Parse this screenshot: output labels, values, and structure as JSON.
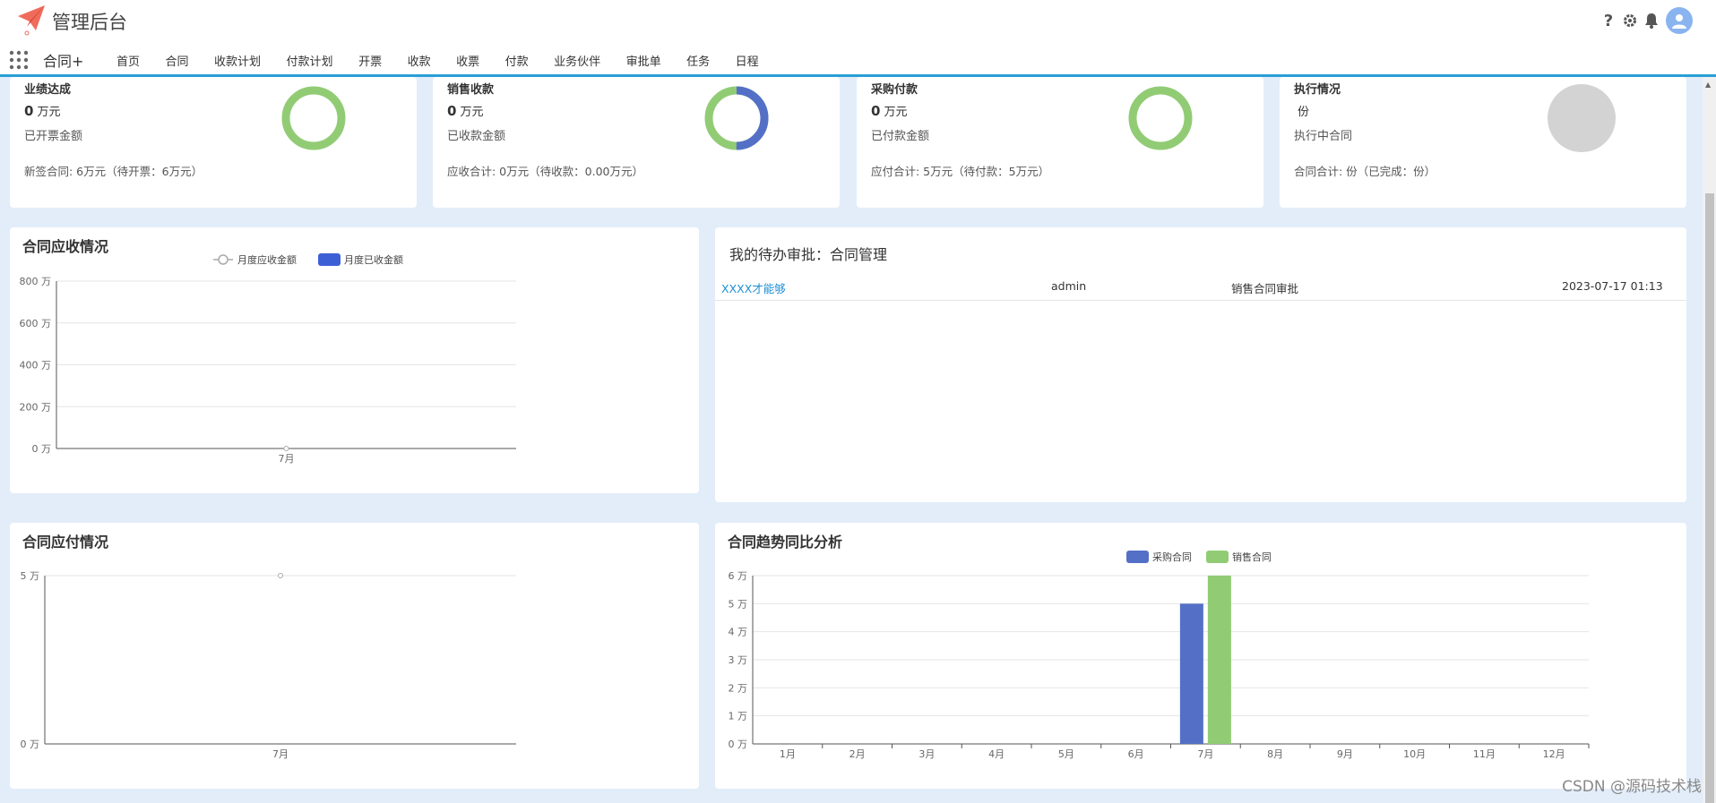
{
  "header": {
    "app_title": "管理后台",
    "module_title": "合同+",
    "nav": [
      "首页",
      "合同",
      "收款计划",
      "付款计划",
      "开票",
      "收款",
      "收票",
      "付款",
      "业务伙伴",
      "审批单",
      "任务",
      "日程"
    ],
    "help_glyph": "?"
  },
  "kpis": [
    {
      "title": "业绩达成",
      "value": "0",
      "unit": "万元",
      "sub": "已开票金额",
      "footer": "新签合同: 6万元（待开票：6万元）",
      "donut": {
        "color": "#91cc75",
        "fraction": 1.0
      }
    },
    {
      "title": "销售收款",
      "value": "0",
      "unit": "万元",
      "sub": "已收款金额",
      "footer": "应收合计: 0万元（待收款：0.00万元）",
      "donut": {
        "color": "#91cc75",
        "accent": "#5470c6",
        "accent_fraction": 0.5
      }
    },
    {
      "title": "采购付款",
      "value": "0",
      "unit": "万元",
      "sub": "已付款金额",
      "footer": "应付合计: 5万元（待付款：5万元）",
      "donut": {
        "color": "#91cc75",
        "fraction": 1.0
      }
    },
    {
      "title": "执行情况",
      "value": "",
      "unit": "份",
      "sub": "执行中合同",
      "footer": "合同合计: 份（已完成：份）",
      "donut": {
        "color": "#d3d3d3",
        "fraction": 0
      }
    }
  ],
  "receivable_panel": {
    "title": "合同应收情况"
  },
  "payable_panel": {
    "title": "合同应付情况"
  },
  "trend_panel": {
    "title": "合同趋势同比分析"
  },
  "approval": {
    "title": "我的待办审批：合同管理",
    "rows": [
      {
        "name": "XXXX才能够",
        "user": "admin",
        "type": "销售合同审批",
        "time": "2023-07-17 01:13"
      }
    ]
  },
  "watermark": "CSDN @源码技术栈",
  "chart_data": [
    {
      "type": "bar",
      "title": "合同应收情况",
      "categories": [
        "7月"
      ],
      "series": [
        {
          "name": "月度应收金额",
          "render": "line",
          "values": [
            0
          ],
          "color": "#aaaaaa"
        },
        {
          "name": "月度已收金额",
          "render": "bar",
          "values": [
            0
          ],
          "color": "#3d5fd6"
        }
      ],
      "ylim": [
        0,
        800
      ],
      "yticks": [
        "0 万",
        "200 万",
        "400 万",
        "600 万",
        "800 万"
      ],
      "legend": "top-center"
    },
    {
      "type": "line",
      "title": "合同应付情况",
      "categories": [
        "7月"
      ],
      "series": [
        {
          "values": [
            5
          ],
          "color": "#aaaaaa"
        }
      ],
      "ylim": [
        0,
        5
      ],
      "yticks": [
        "0 万",
        "5 万"
      ]
    },
    {
      "type": "bar",
      "title": "合同趋势同比分析",
      "categories": [
        "1月",
        "2月",
        "3月",
        "4月",
        "5月",
        "6月",
        "7月",
        "8月",
        "9月",
        "10月",
        "11月",
        "12月"
      ],
      "series": [
        {
          "name": "采购合同",
          "values": [
            0,
            0,
            0,
            0,
            0,
            0,
            5,
            0,
            0,
            0,
            0,
            0
          ],
          "color": "#5470c6"
        },
        {
          "name": "销售合同",
          "values": [
            0,
            0,
            0,
            0,
            0,
            0,
            6,
            0,
            0,
            0,
            0,
            0
          ],
          "color": "#91cc75"
        }
      ],
      "ylim": [
        0,
        6
      ],
      "yticks": [
        "0 万",
        "1 万",
        "2 万",
        "3 万",
        "4 万",
        "5 万",
        "6 万"
      ],
      "legend": "top-center"
    }
  ]
}
